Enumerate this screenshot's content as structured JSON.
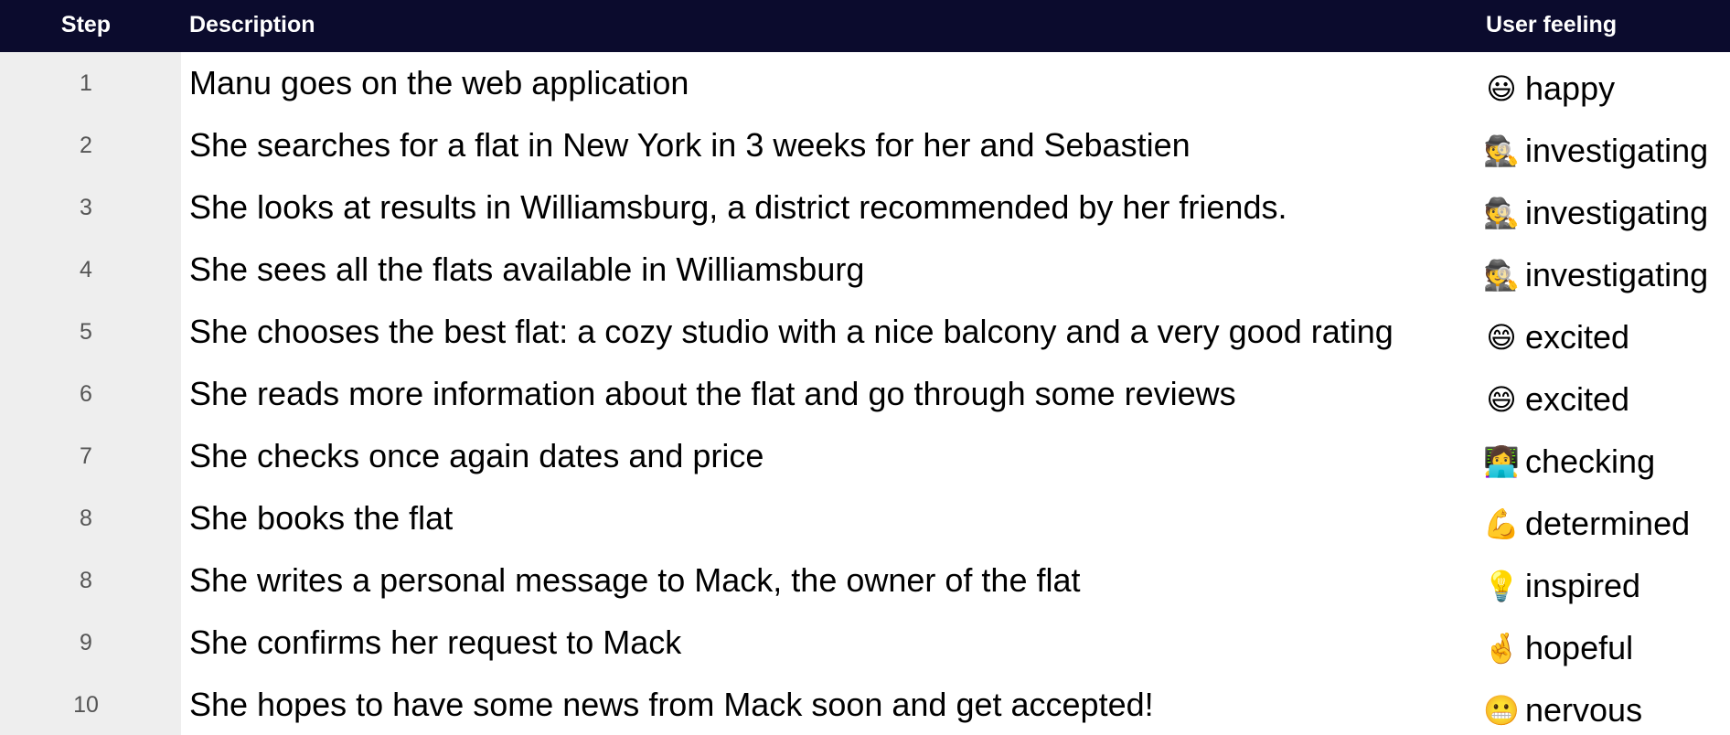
{
  "header": {
    "step": "Step",
    "description": "Description",
    "feeling": "User feeling"
  },
  "rows": [
    {
      "step": "1",
      "description": "Manu goes on the web application",
      "emoji": "😃",
      "emoji_name": "smiley-face-icon",
      "feeling": "happy"
    },
    {
      "step": "2",
      "description": "She searches for a flat in New York in 3 weeks for her and Sebastien",
      "emoji": "🕵️",
      "emoji_name": "detective-icon",
      "feeling": "investigating"
    },
    {
      "step": "3",
      "description": "She looks at results in Williamsburg, a district recommended by her friends.",
      "emoji": "🕵️",
      "emoji_name": "detective-icon",
      "feeling": "investigating"
    },
    {
      "step": "4",
      "description": "She sees all the flats available in Williamsburg",
      "emoji": "🕵️",
      "emoji_name": "detective-icon",
      "feeling": "investigating"
    },
    {
      "step": "5",
      "description": "She chooses the best flat: a cozy studio with a nice balcony and a very good rating",
      "emoji": "😄",
      "emoji_name": "grinning-face-icon",
      "feeling": "excited"
    },
    {
      "step": "6",
      "description": "She reads more information about the flat and go through some reviews",
      "emoji": "😄",
      "emoji_name": "grinning-face-icon",
      "feeling": "excited"
    },
    {
      "step": "7",
      "description": "She checks once again dates and price",
      "emoji": "👩‍💻",
      "emoji_name": "person-laptop-icon",
      "feeling": "checking"
    },
    {
      "step": "8",
      "description": "She books the flat",
      "emoji": "💪",
      "emoji_name": "flexed-biceps-icon",
      "feeling": "determined"
    },
    {
      "step": "8",
      "description": "She writes a personal message to Mack, the owner of the flat",
      "emoji": "💡",
      "emoji_name": "light-bulb-icon",
      "feeling": "inspired"
    },
    {
      "step": "9",
      "description": "She confirms her request to Mack",
      "emoji": "🤞",
      "emoji_name": "crossed-fingers-icon",
      "feeling": "hopeful"
    },
    {
      "step": "10",
      "description": "She hopes to have some news from Mack soon and get accepted!",
      "emoji": "😬",
      "emoji_name": "grimacing-face-icon",
      "feeling": "nervous"
    }
  ]
}
